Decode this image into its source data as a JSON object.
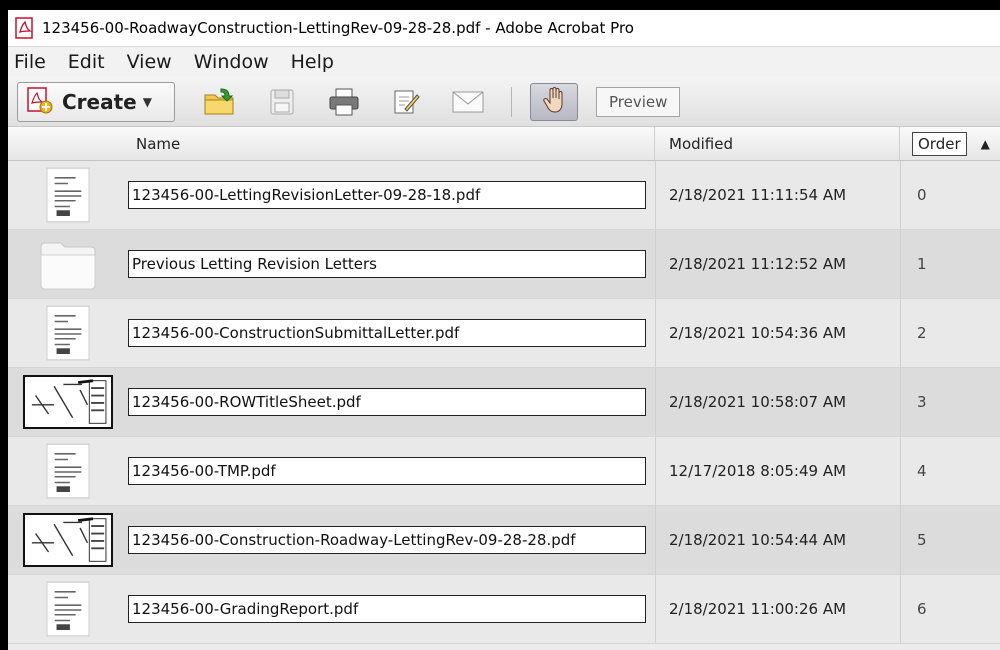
{
  "window": {
    "title": "123456-00-RoadwayConstruction-LettingRev-09-28-28.pdf - Adobe Acrobat Pro"
  },
  "menu": [
    "File",
    "Edit",
    "View",
    "Window",
    "Help"
  ],
  "toolbar": {
    "create_label": "Create",
    "preview_label": "Preview",
    "icons": [
      "open-folder-icon",
      "save-icon",
      "print-icon",
      "edit-icon",
      "email-icon",
      "hand-tool-icon"
    ]
  },
  "table": {
    "headers": {
      "name": "Name",
      "modified": "Modified",
      "order": "Order"
    },
    "rows": [
      {
        "name": "123456-00-LettingRevisionLetter-09-28-18.pdf",
        "modified": "2/18/2021 11:11:54 AM",
        "order": "0",
        "thumb": "document"
      },
      {
        "name": "Previous Letting Revision Letters",
        "modified": "2/18/2021 11:12:52 AM",
        "order": "1",
        "thumb": "folder"
      },
      {
        "name": "123456-00-ConstructionSubmittalLetter.pdf",
        "modified": "2/18/2021 10:54:36 AM",
        "order": "2",
        "thumb": "document"
      },
      {
        "name": "123456-00-ROWTitleSheet.pdf",
        "modified": "2/18/2021 10:58:07 AM",
        "order": "3",
        "thumb": "plan-sheet"
      },
      {
        "name": "123456-00-TMP.pdf",
        "modified": "12/17/2018 8:05:49 AM",
        "order": "4",
        "thumb": "document"
      },
      {
        "name": "123456-00-Construction-Roadway-LettingRev-09-28-28.pdf",
        "modified": "2/18/2021 10:54:44 AM",
        "order": "5",
        "thumb": "plan-sheet"
      },
      {
        "name": "123456-00-GradingReport.pdf",
        "modified": "2/18/2021 11:00:26 AM",
        "order": "6",
        "thumb": "document"
      }
    ]
  },
  "colors": {
    "pdf_red": "#c8102e",
    "row_alt": "#dcdcdc",
    "row_norm": "#e9e9e9"
  }
}
